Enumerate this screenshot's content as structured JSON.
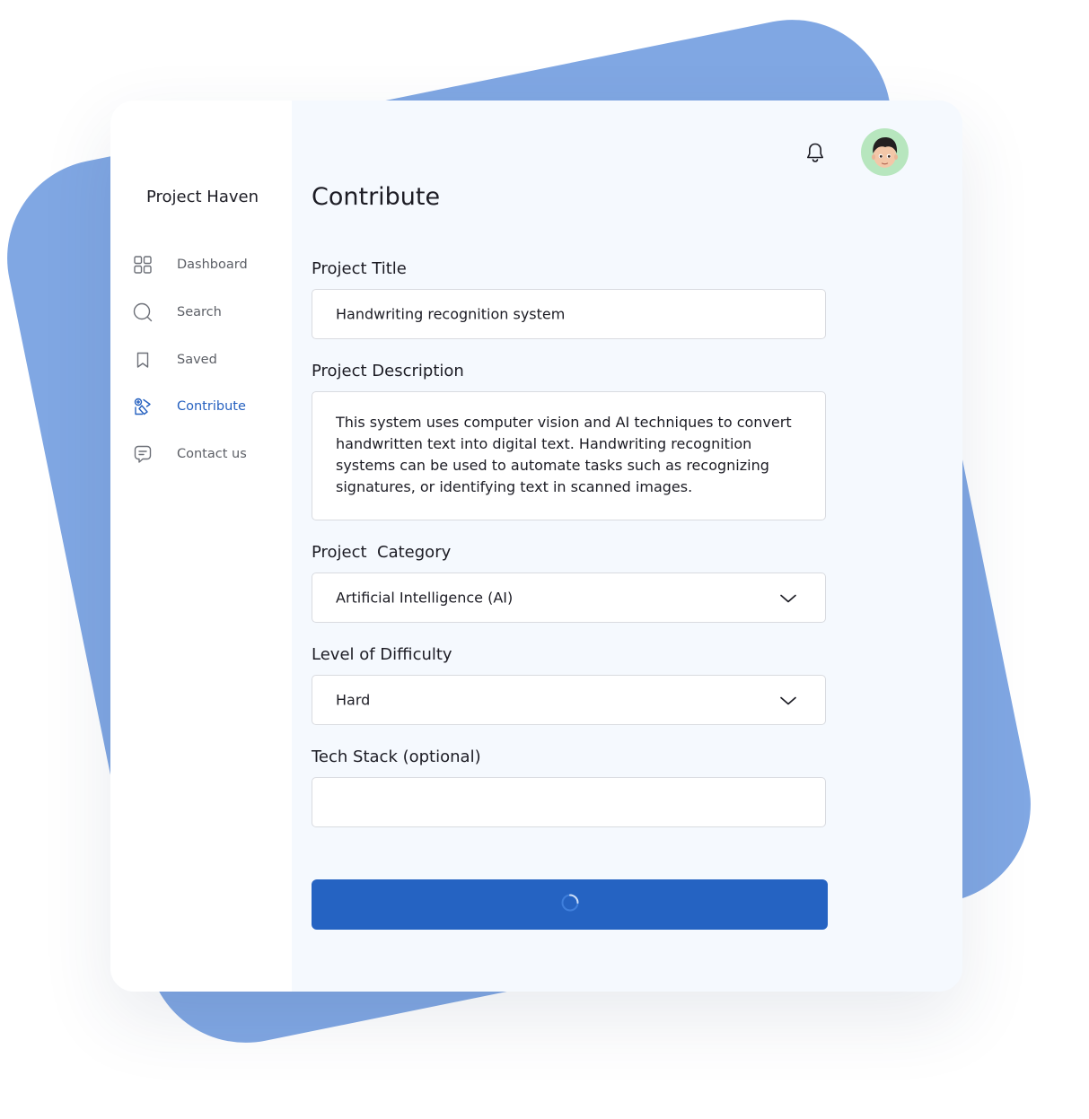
{
  "app": {
    "brand": "Project Haven"
  },
  "sidebar": {
    "items": [
      {
        "label": "Dashboard",
        "icon": "grid-icon",
        "active": false
      },
      {
        "label": "Search",
        "icon": "search-icon",
        "active": false
      },
      {
        "label": "Saved",
        "icon": "bookmark-icon",
        "active": false
      },
      {
        "label": "Contribute",
        "icon": "contribute-icon",
        "active": true
      },
      {
        "label": "Contact us",
        "icon": "chat-icon",
        "active": false
      }
    ]
  },
  "header": {
    "notification_icon": "bell-icon",
    "avatar_icon": "user-avatar-icon"
  },
  "form": {
    "title": "Contribute",
    "project_title": {
      "label": "Project Title",
      "value": "Handwriting recognition system"
    },
    "project_description": {
      "label": "Project Description",
      "value": "This system uses computer vision and AI techniques to convert handwritten text into digital text. Handwriting recognition systems can be used to automate tasks such as recognizing signatures, or identifying text in scanned images."
    },
    "project_category": {
      "label": "Project  Category",
      "value": "Artificial Intelligence (AI)"
    },
    "difficulty": {
      "label": "Level of Difficulty",
      "value": "Hard"
    },
    "tech_stack": {
      "label": "Tech Stack (optional)",
      "value": ""
    },
    "submit": {
      "state": "loading",
      "icon": "spinner-icon"
    }
  },
  "colors": {
    "accent": "#2563c2",
    "background_card": "#80a7e3",
    "main_bg": "#f5f9fe",
    "avatar_bg": "#b7e6be"
  }
}
